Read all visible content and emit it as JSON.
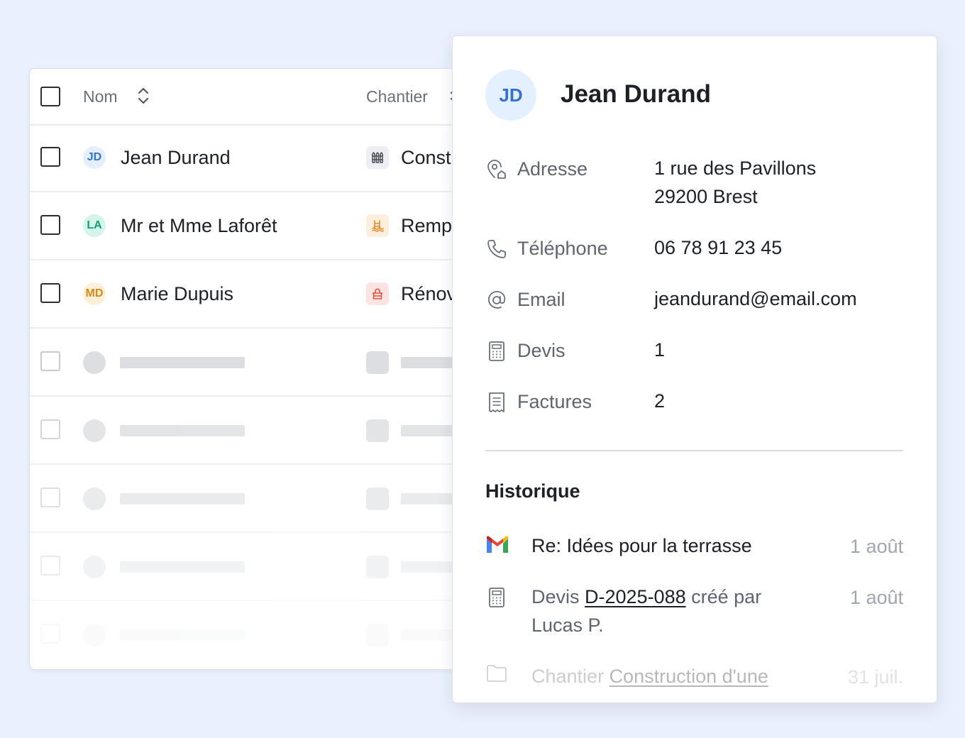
{
  "list": {
    "header": {
      "name_label": "Nom",
      "project_label": "Chantier"
    },
    "rows": [
      {
        "initials": "JD",
        "name": "Jean Durand",
        "project": "Const"
      },
      {
        "initials": "LA",
        "name": "Mr et Mme Laforêt",
        "project": "Remp"
      },
      {
        "initials": "MD",
        "name": "Marie Dupuis",
        "project": "Rénov"
      }
    ]
  },
  "detail": {
    "initials": "JD",
    "name": "Jean Durand",
    "fields": {
      "address": {
        "label": "Adresse",
        "line1": "1 rue des Pavillons",
        "line2": "29200 Brest"
      },
      "phone": {
        "label": "Téléphone",
        "value": "06 78 91 23 45"
      },
      "email": {
        "label": "Email",
        "value": "jeandurand@email.com"
      },
      "quotes": {
        "label": "Devis",
        "value": "1"
      },
      "invoices": {
        "label": "Factures",
        "value": "2"
      }
    },
    "history": {
      "title": "Historique",
      "items": [
        {
          "icon": "gmail-icon",
          "text": "Re: Idées pour la terrasse",
          "date": "1 août"
        },
        {
          "icon": "calculator-icon",
          "prefix": "Devis ",
          "link": "D-2025-088",
          "suffix": " créé par Lucas P.",
          "date": "1 août"
        },
        {
          "icon": "folder-icon",
          "prefix": "Chantier ",
          "link": "Construction d'une",
          "date": "31 juil."
        }
      ]
    }
  },
  "colors": {
    "background": "#eaf0fd",
    "avatar_jd": "#2f73d4",
    "avatar_la": "#12a37a",
    "avatar_md": "#d98a12"
  }
}
